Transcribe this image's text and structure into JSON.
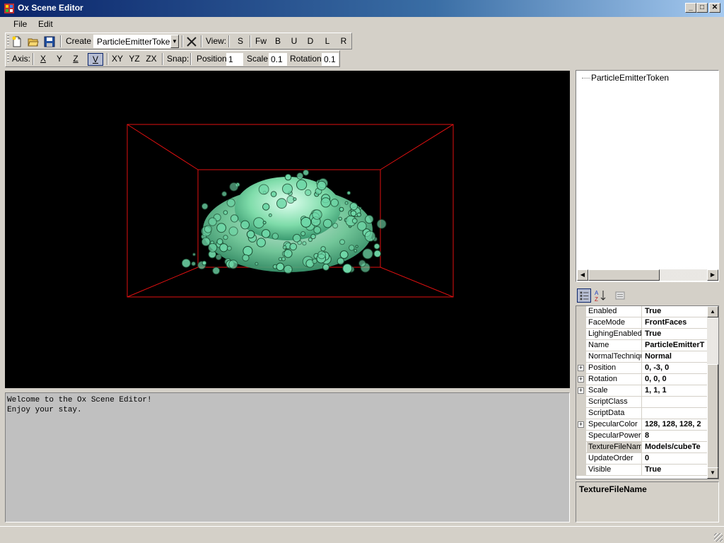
{
  "window": {
    "title": "Ox Scene Editor",
    "minimize": "_",
    "maximize": "□",
    "close": "✕"
  },
  "menu": {
    "file": "File",
    "edit": "Edit"
  },
  "toolbar1": {
    "create_label": "Create",
    "create_value": "ParticleEmitterToken",
    "view_label": "View:",
    "views": [
      "S",
      "Fw",
      "B",
      "U",
      "D",
      "L",
      "R"
    ]
  },
  "toolbar2": {
    "axis_label": "Axis:",
    "axes": [
      "X",
      "Y",
      "Z",
      "V",
      "XY",
      "YZ",
      "ZX"
    ],
    "snap_label": "Snap:",
    "position_label": "Position",
    "position_value": "1",
    "scale_label": "Scale",
    "scale_value": "0.1",
    "rotation_label": "Rotation",
    "rotation_value": "0.1"
  },
  "console": {
    "lines": [
      "Welcome to the Ox Scene Editor!",
      "Enjoy your stay."
    ]
  },
  "tree": {
    "items": [
      "ParticleEmitterToken"
    ]
  },
  "properties": [
    {
      "name": "Enabled",
      "value": "True",
      "expandable": false
    },
    {
      "name": "FaceMode",
      "value": "FrontFaces",
      "expandable": false
    },
    {
      "name": "LighingEnabled",
      "value": "True",
      "expandable": false
    },
    {
      "name": "Name",
      "value": "ParticleEmitterT",
      "expandable": false
    },
    {
      "name": "NormalTechniqu",
      "value": "Normal",
      "expandable": false
    },
    {
      "name": "Position",
      "value": "0, -3, 0",
      "expandable": true
    },
    {
      "name": "Rotation",
      "value": "0, 0, 0",
      "expandable": true
    },
    {
      "name": "Scale",
      "value": "1, 1, 1",
      "expandable": true
    },
    {
      "name": "ScriptClass",
      "value": "",
      "expandable": false
    },
    {
      "name": "ScriptData",
      "value": "",
      "expandable": false
    },
    {
      "name": "SpecularColor",
      "value": "128, 128, 128, 2",
      "expandable": true
    },
    {
      "name": "SpecularPower",
      "value": "8",
      "expandable": false
    },
    {
      "name": "TextureFileNam",
      "value": "Models/cubeTe",
      "expandable": false,
      "selected": true
    },
    {
      "name": "UpdateOrder",
      "value": "0",
      "expandable": false
    },
    {
      "name": "Visible",
      "value": "True",
      "expandable": false
    }
  ],
  "description": {
    "title": "TextureFileName"
  },
  "colors": {
    "particle": "#6fd8a8",
    "box": "#e01010"
  }
}
